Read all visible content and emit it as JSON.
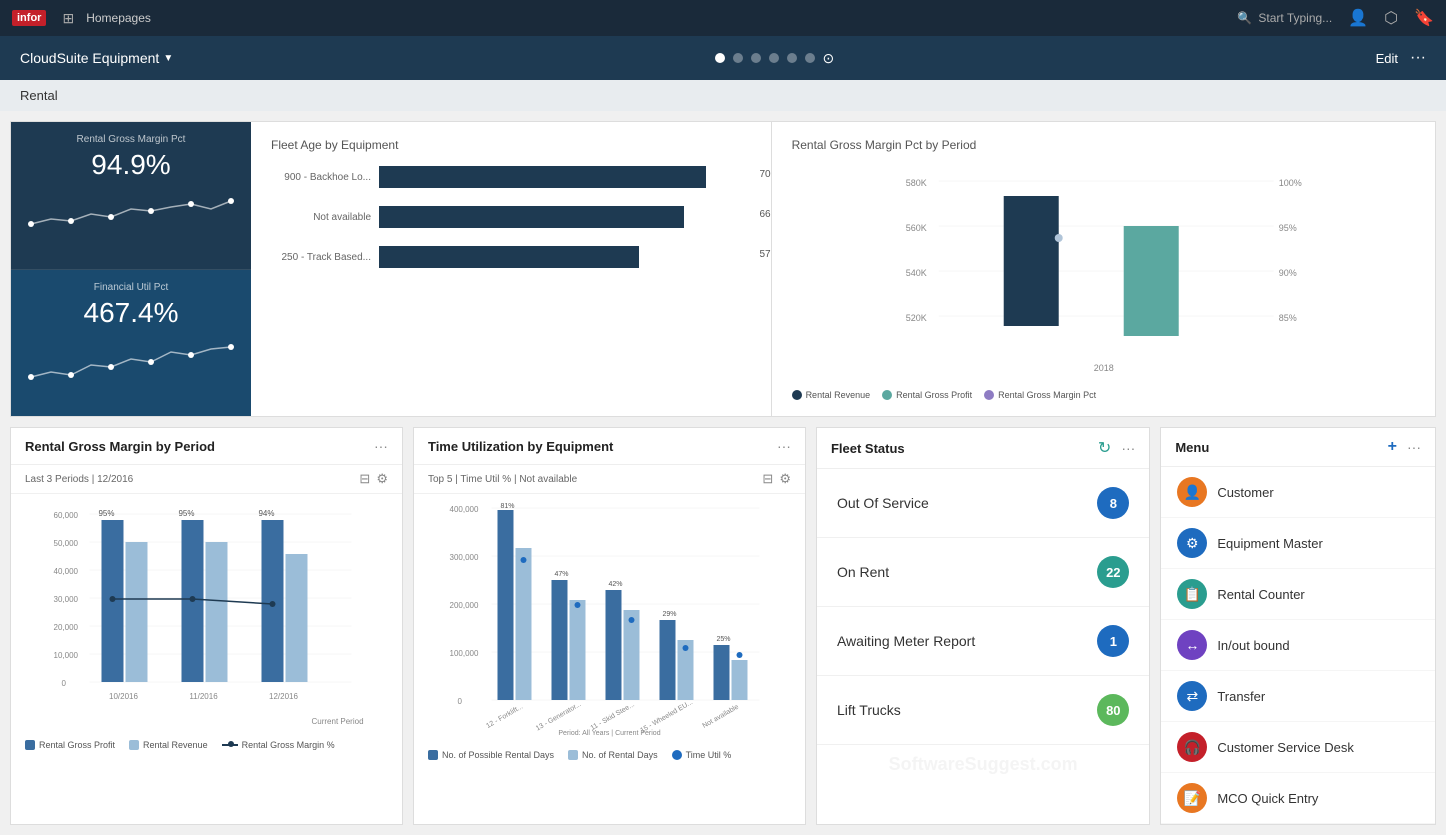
{
  "brand": {
    "logo": "infor",
    "nav_label": "Homepages"
  },
  "nav": {
    "search_placeholder": "Start Typing...",
    "user_icon": "👤",
    "share_icon": "⬡",
    "bookmark_icon": "🔖"
  },
  "app": {
    "title": "CloudSuite Equipment",
    "title_caret": "▼",
    "edit_label": "Edit",
    "more_label": "···"
  },
  "page_dots": [
    {
      "active": true
    },
    {
      "active": false
    },
    {
      "active": false
    },
    {
      "active": false
    },
    {
      "active": false
    },
    {
      "active": false
    }
  ],
  "section": {
    "label": "Rental"
  },
  "kpi": [
    {
      "label": "Rental Gross Margin Pct",
      "value": "94.9%"
    },
    {
      "label": "Financial Util Pct",
      "value": "467.4%"
    }
  ],
  "fleet_age": {
    "title": "Fleet Age by Equipment",
    "bars": [
      {
        "label": "900 - Backhoe Lo...",
        "value": 70,
        "max": 100
      },
      {
        "label": "Not available",
        "value": 66,
        "max": 100
      },
      {
        "label": "250 - Track Based...",
        "value": 57,
        "max": 100
      }
    ]
  },
  "rental_margin": {
    "title": "Rental Gross Margin Pct by Period",
    "y_left": [
      "580K",
      "560K",
      "540K",
      "520K"
    ],
    "y_right": [
      "100%",
      "95%",
      "90%",
      "85%"
    ],
    "x_label": "2018",
    "legend": [
      "Rental Revenue",
      "Rental Gross Profit",
      "Rental Gross Margin Pct"
    ]
  },
  "rental_by_period": {
    "title": "Rental Gross Margin by Period",
    "more": "···",
    "subheader": "Last 3 Periods | 12/2016",
    "filter_icon": "⊟",
    "settings_icon": "⚙",
    "y_labels": [
      "60,000",
      "50,000",
      "40,000",
      "30,000",
      "20,000",
      "10,000",
      "0"
    ],
    "x_labels": [
      "10/2016",
      "11/2016",
      "12/2016"
    ],
    "bar_pcts": [
      "95%",
      "95%",
      "94%"
    ],
    "legend": [
      "Rental Gross Profit",
      "Rental Revenue",
      "Rental Gross Margin %"
    ],
    "current_period": "Current Period"
  },
  "time_util": {
    "title": "Time Utilization by Equipment",
    "more": "···",
    "subheader": "Top 5 | Time Util % | Not available",
    "filter_icon": "⊟",
    "settings_icon": "⚙",
    "y_labels": [
      "400,000",
      "300,000",
      "200,000",
      "100,000",
      "0"
    ],
    "x_labels": [
      "12 - Forklift...",
      "13 - Generator...",
      "11 - Skid Stee...",
      "15 - Wheeled EU...",
      "Not available"
    ],
    "bar_pcts": [
      "81%",
      "47%",
      "42%",
      "29%",
      "25%"
    ],
    "legend": [
      "No. of Possible Rental Days",
      "No. of Rental Days",
      "Time Util %"
    ],
    "period": "Period: All Years | Current Period"
  },
  "fleet_status": {
    "title": "Fleet Status",
    "more": "···",
    "items": [
      {
        "name": "Out Of Service",
        "count": 8,
        "color": "badge-blue"
      },
      {
        "name": "On Rent",
        "count": 22,
        "color": "badge-teal"
      },
      {
        "name": "Awaiting Meter Report",
        "count": 1,
        "color": "badge-blue"
      },
      {
        "name": "Lift Trucks",
        "count": 80,
        "color": "badge-green"
      }
    ]
  },
  "menu": {
    "title": "Menu",
    "add_icon": "+",
    "more_icon": "···",
    "items": [
      {
        "label": "Customer",
        "icon_type": "orange",
        "icon": "👤"
      },
      {
        "label": "Equipment Master",
        "icon_type": "blue",
        "icon": "⚙"
      },
      {
        "label": "Rental Counter",
        "icon_type": "teal",
        "icon": "📋"
      },
      {
        "label": "In/out bound",
        "icon_type": "purple",
        "icon": "↔"
      },
      {
        "label": "Transfer",
        "icon_type": "blue",
        "icon": "⇄"
      },
      {
        "label": "Customer Service Desk",
        "icon_type": "red",
        "icon": "🎧"
      },
      {
        "label": "MCO Quick Entry",
        "icon_type": "orange",
        "icon": "📝"
      }
    ]
  }
}
